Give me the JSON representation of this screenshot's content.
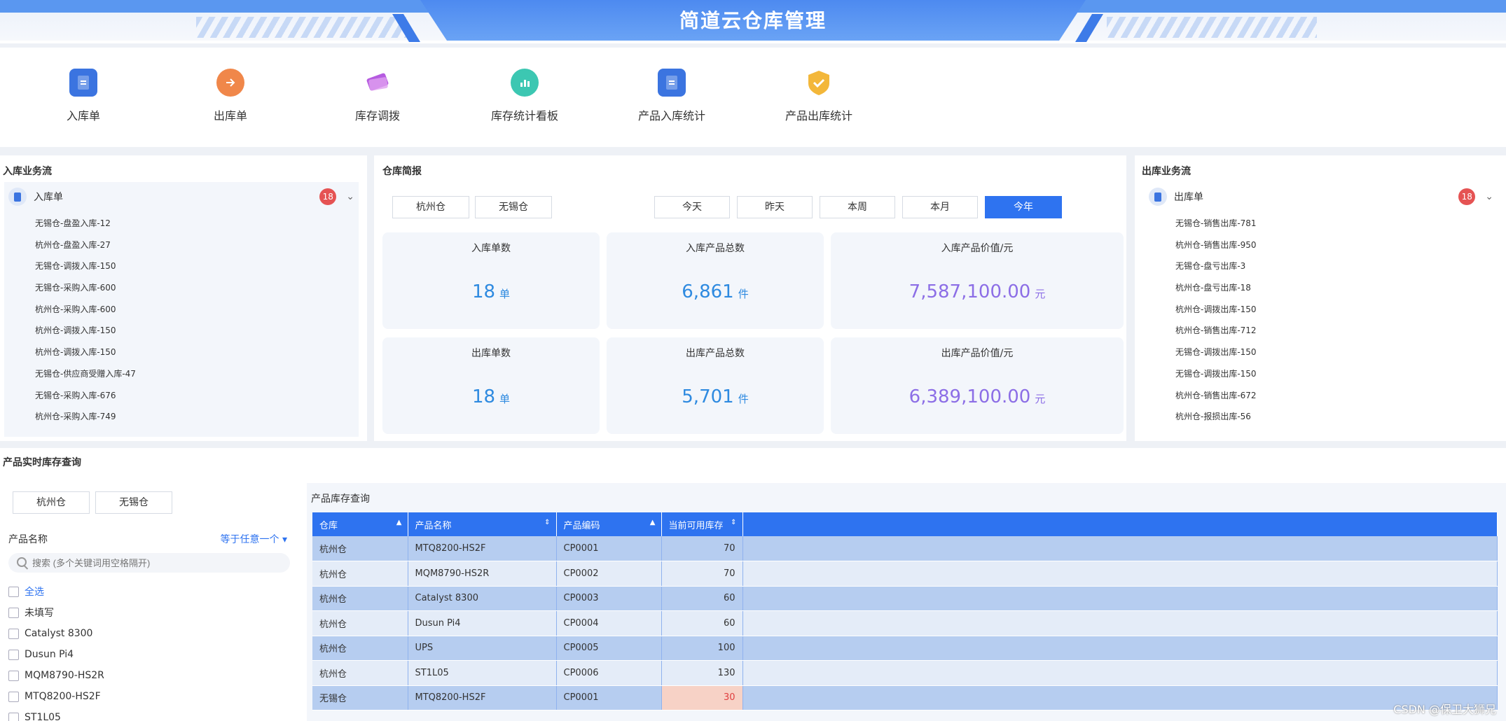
{
  "app": {
    "title": "简道云仓库管理"
  },
  "quicknav": [
    {
      "label": "入库单",
      "icon": "document-icon",
      "color": "#3b74e0"
    },
    {
      "label": "出库单",
      "icon": "export-icon",
      "color": "#f0874a"
    },
    {
      "label": "库存调拨",
      "icon": "transfer-card-icon",
      "color": "#b55be0"
    },
    {
      "label": "库存统计看板",
      "icon": "chart-dashboard-icon",
      "color": "#3cc7b2"
    },
    {
      "label": "产品入库统计",
      "icon": "document-stats-icon",
      "color": "#3b74e0"
    },
    {
      "label": "产品出库统计",
      "icon": "shield-check-icon",
      "color": "#f3b73a"
    }
  ],
  "inbound": {
    "title": "入库业务流",
    "head": "入库单",
    "badge": "18",
    "items": [
      "无锡仓-盘盈入库-12",
      "杭州仓-盘盈入库-27",
      "无锡仓-调拨入库-150",
      "无锡仓-采购入库-600",
      "杭州仓-采购入库-600",
      "杭州仓-调拨入库-150",
      "杭州仓-调拨入库-150",
      "无锡仓-供应商受赠入库-47",
      "无锡仓-采购入库-676",
      "杭州仓-采购入库-749"
    ]
  },
  "outbound": {
    "title": "出库业务流",
    "head": "出库单",
    "badge": "18",
    "items": [
      "无锡仓-销售出库-781",
      "杭州仓-销售出库-950",
      "无锡仓-盘亏出库-3",
      "杭州仓-盘亏出库-18",
      "杭州仓-调拨出库-150",
      "杭州仓-销售出库-712",
      "无锡仓-调拨出库-150",
      "无锡仓-调拨出库-150",
      "杭州仓-销售出库-672",
      "杭州仓-报损出库-56"
    ]
  },
  "brief": {
    "title": "仓库简报",
    "warehouses": [
      "杭州仓",
      "无锡仓"
    ],
    "periods": [
      "今天",
      "昨天",
      "本周",
      "本月",
      "今年"
    ],
    "active_period": "今年",
    "stats": [
      {
        "label": "入库单数",
        "value": "18",
        "unit": "单"
      },
      {
        "label": "入库产品总数",
        "value": "6,861",
        "unit": "件"
      },
      {
        "label": "入库产品价值/元",
        "value": "7,587,100.00",
        "unit": "元"
      },
      {
        "label": "出库单数",
        "value": "18",
        "unit": "单"
      },
      {
        "label": "出库产品总数",
        "value": "5,701",
        "unit": "件"
      },
      {
        "label": "出库产品价值/元",
        "value": "6,389,100.00",
        "unit": "元"
      }
    ]
  },
  "inventory": {
    "title": "产品实时库存查询",
    "warehouses": [
      "杭州仓",
      "无锡仓"
    ],
    "filter_label": "产品名称",
    "filter_mode": "等于任意一个",
    "search_placeholder": "搜索 (多个关键词用空格隔开)",
    "options": [
      "全选",
      "未填写",
      "Catalyst 8300",
      "Dusun Pi4",
      "MQM8790-HS2R",
      "MTQ8200-HS2F",
      "ST1L05"
    ],
    "table_title": "产品库存查询",
    "columns": [
      "仓库",
      "产品名称",
      "产品编码",
      "当前可用库存"
    ],
    "rows": [
      [
        "杭州仓",
        "MTQ8200-HS2F",
        "CP0001",
        "70"
      ],
      [
        "杭州仓",
        "MQM8790-HS2R",
        "CP0002",
        "70"
      ],
      [
        "杭州仓",
        "Catalyst 8300",
        "CP0003",
        "60"
      ],
      [
        "杭州仓",
        "Dusun Pi4",
        "CP0004",
        "60"
      ],
      [
        "杭州仓",
        "UPS",
        "CP0005",
        "100"
      ],
      [
        "杭州仓",
        "ST1L05",
        "CP0006",
        "130"
      ],
      [
        "无锡仓",
        "MTQ8200-HS2F",
        "CP0001",
        "30"
      ]
    ],
    "low_stock_color": "#e04040"
  },
  "watermark": "CSDN @保卫大狮兄"
}
